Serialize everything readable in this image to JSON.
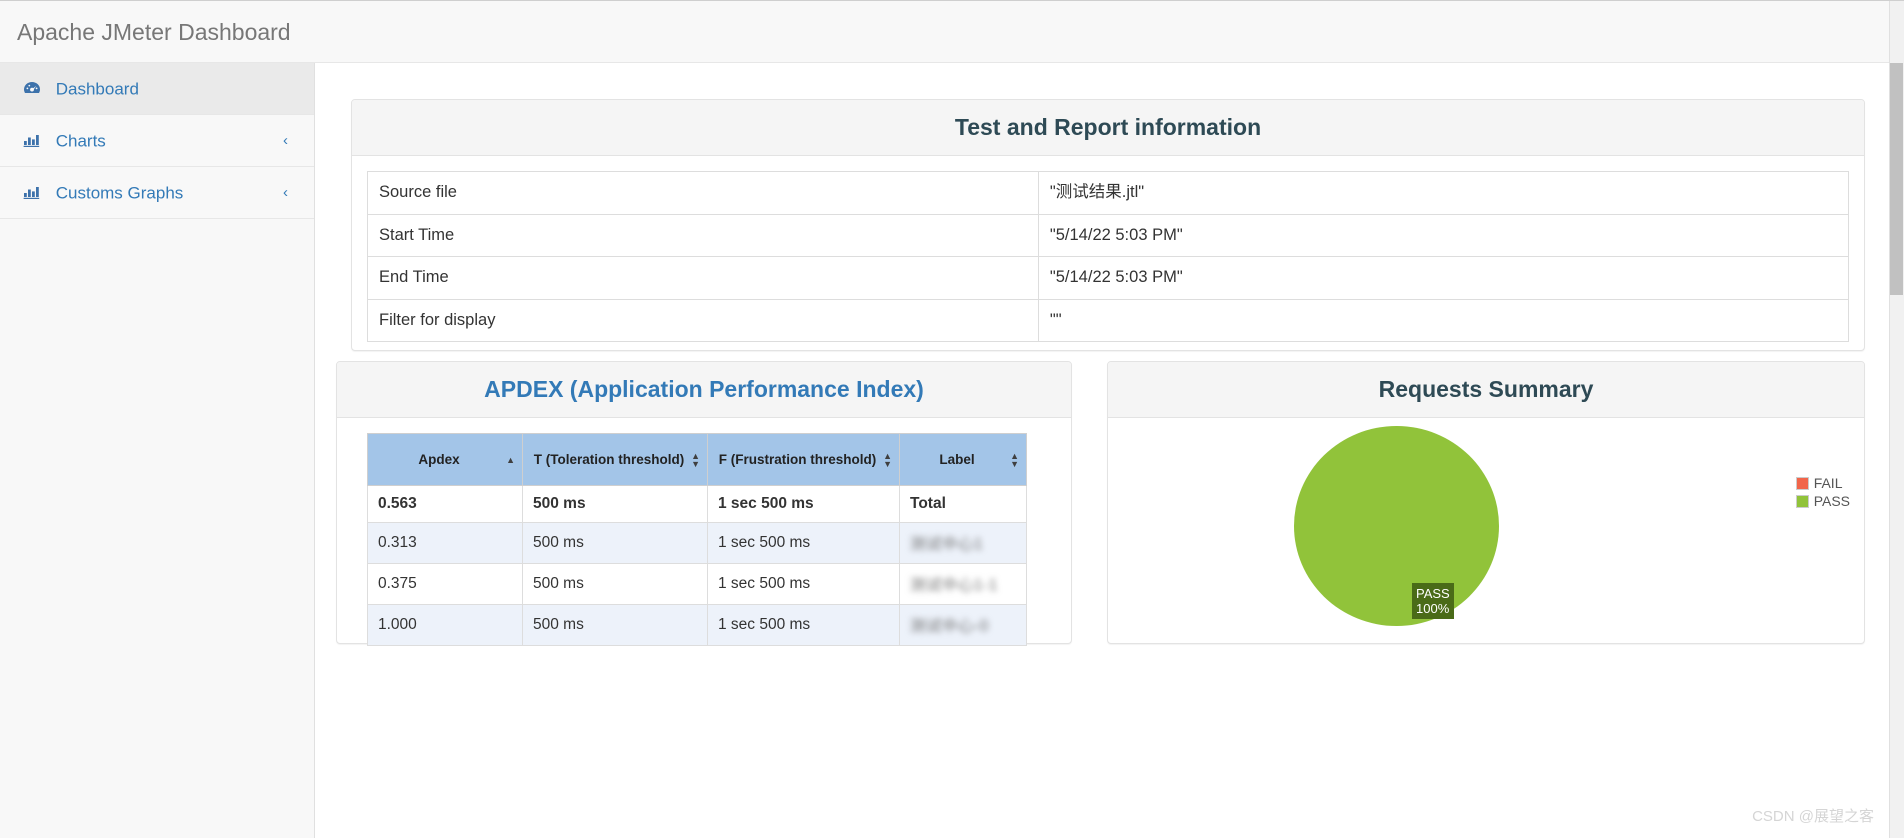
{
  "header": {
    "title": "Apache JMeter Dashboard"
  },
  "sidebar": {
    "items": [
      {
        "label": "Dashboard",
        "icon": "tachometer-icon",
        "active": true,
        "chevron": ""
      },
      {
        "label": "Charts",
        "icon": "bar-chart-icon",
        "active": false,
        "chevron": "‹"
      },
      {
        "label": "Customs Graphs",
        "icon": "bar-chart-icon",
        "active": false,
        "chevron": "‹"
      }
    ]
  },
  "test_info": {
    "title": "Test and Report information",
    "rows": [
      {
        "key": "Source file",
        "value": "\"测试结果.jtl\""
      },
      {
        "key": "Start Time",
        "value": "\"5/14/22 5:03 PM\""
      },
      {
        "key": "End Time",
        "value": "\"5/14/22 5:03 PM\""
      },
      {
        "key": "Filter for display",
        "value": "\"\""
      }
    ]
  },
  "apdex": {
    "title": "APDEX (Application Performance Index)",
    "columns": [
      {
        "label": "Apdex",
        "sort": "asc"
      },
      {
        "label": "T (Toleration threshold)",
        "sort": "none"
      },
      {
        "label": "F (Frustration threshold)",
        "sort": "none"
      },
      {
        "label": "Label",
        "sort": "none"
      }
    ],
    "rows": [
      {
        "apdex": "0.563",
        "t": "500 ms",
        "f": "1 sec 500 ms",
        "label": "Total",
        "label_redacted": false,
        "total": true
      },
      {
        "apdex": "0.313",
        "t": "500 ms",
        "f": "1 sec 500 ms",
        "label": "测试中心1",
        "label_redacted": true,
        "total": false
      },
      {
        "apdex": "0.375",
        "t": "500 ms",
        "f": "1 sec 500 ms",
        "label": "测试中心1-1",
        "label_redacted": true,
        "total": false
      },
      {
        "apdex": "1.000",
        "t": "500 ms",
        "f": "1 sec 500 ms",
        "label": "测试中心-0",
        "label_redacted": true,
        "total": false
      }
    ]
  },
  "requests_summary": {
    "title": "Requests Summary"
  },
  "chart_data": {
    "type": "pie",
    "title": "Requests Summary",
    "labels": [
      "FAIL",
      "PASS"
    ],
    "values": [
      0,
      100
    ],
    "value_labels": [
      "FAIL 0%",
      "PASS 100%"
    ],
    "slice_label": {
      "name": "PASS",
      "percent": "100%"
    },
    "colors": {
      "FAIL": "#f1654a",
      "PASS": "#91c33a"
    },
    "legend_position": "right",
    "units": "percent"
  },
  "colors": {
    "link": "#337ab7",
    "panel_title": "#2e4a55",
    "table_header": "#a3c5e8",
    "pass": "#91c33a",
    "fail": "#f1654a",
    "pie_label_bg": "#4a6b18"
  },
  "watermark": {
    "text": "CSDN @展望之客"
  }
}
